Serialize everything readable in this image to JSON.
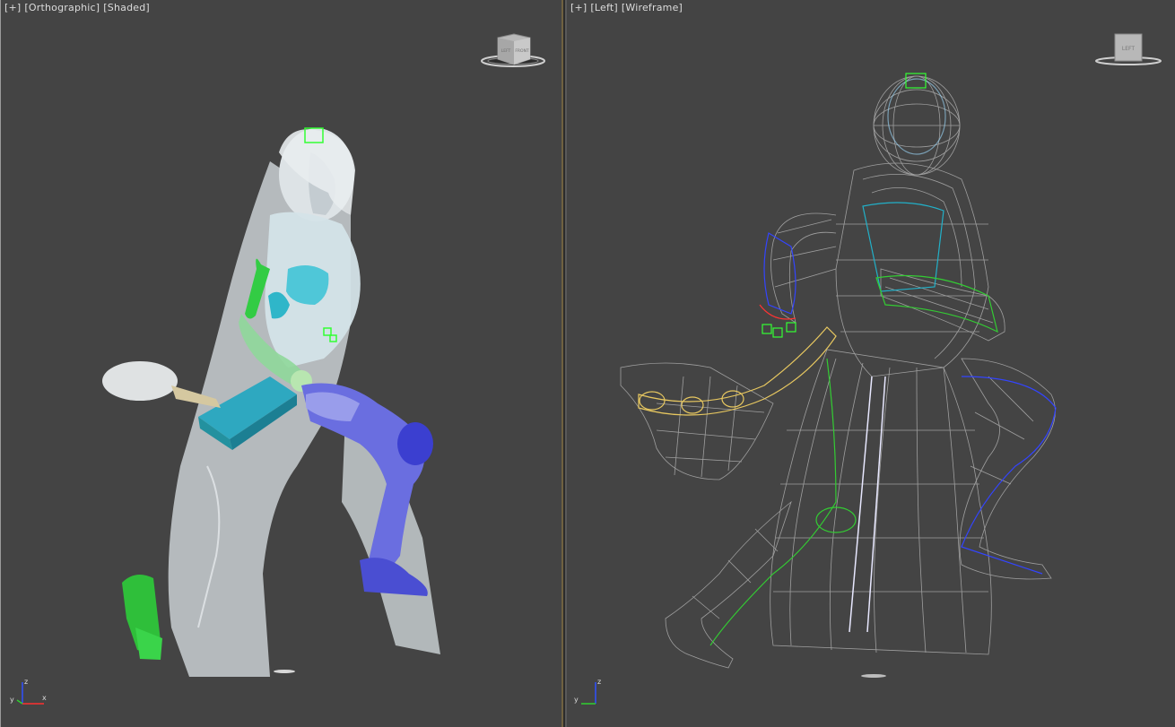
{
  "left_viewport": {
    "label_plus": "[+]",
    "label_view": "[Orthographic]",
    "label_mode": "[Shaded]",
    "viewcube": {
      "face_left": "LEFT",
      "face_front": "FRONT"
    },
    "axes": {
      "z": "z",
      "y": "y",
      "x": "x"
    }
  },
  "right_viewport": {
    "label_plus": "[+]",
    "label_view": "[Left]",
    "label_mode": "[Wireframe]",
    "viewcube": {
      "face_left": "LEFT"
    },
    "axes": {
      "z": "z",
      "y": "y"
    }
  },
  "colors": {
    "viewport_bg": "#444444",
    "skin_shaded": "#d8e0e3",
    "bone_green": "#33cc33",
    "bone_blue": "#3333cc",
    "bone_cyan": "#22b0c8",
    "bone_yellow": "#e8c860",
    "wire_grey": "#9a9a9a",
    "active_border": "#6f6140"
  }
}
